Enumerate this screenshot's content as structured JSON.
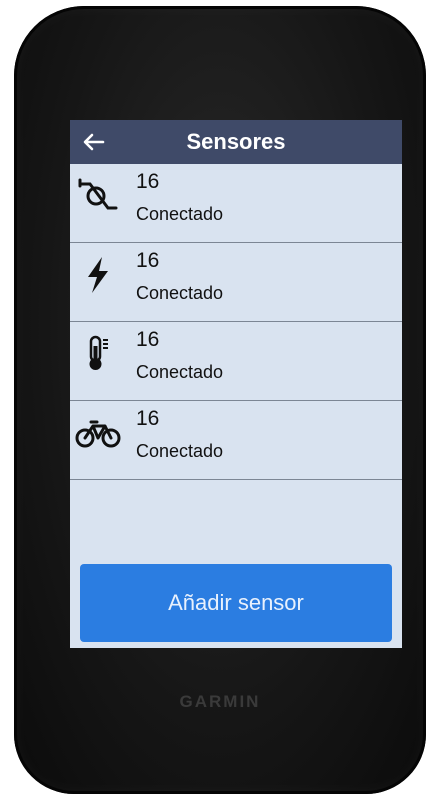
{
  "header": {
    "title": "Sensores"
  },
  "sensors": [
    {
      "icon": "pedal-sensor-icon",
      "value": "16",
      "status": "Conectado"
    },
    {
      "icon": "power-bolt-icon",
      "value": "16",
      "status": "Conectado"
    },
    {
      "icon": "thermometer-icon",
      "value": "16",
      "status": "Conectado"
    },
    {
      "icon": "bike-icon",
      "value": "16",
      "status": "Conectado"
    }
  ],
  "add_button": {
    "label": "Añadir sensor"
  },
  "device": {
    "brand": "GARMIN"
  },
  "colors": {
    "screen_bg": "#d9e3f0",
    "header_bg": "#3f4a68",
    "accent": "#2b7de1"
  }
}
